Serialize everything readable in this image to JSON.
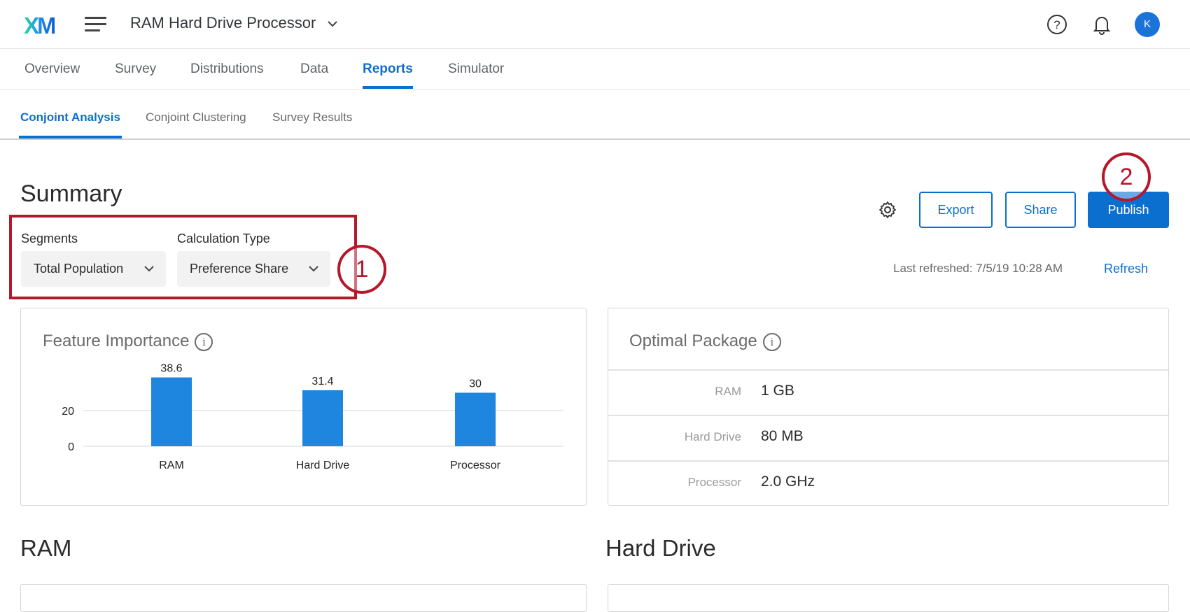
{
  "header": {
    "logo": "XM",
    "project_title": "RAM Hard Drive Processor",
    "avatar_initial": "K"
  },
  "tabs": [
    {
      "label": "Overview"
    },
    {
      "label": "Survey"
    },
    {
      "label": "Distributions"
    },
    {
      "label": "Data"
    },
    {
      "label": "Reports",
      "active": true
    },
    {
      "label": "Simulator"
    }
  ],
  "subtabs": [
    {
      "label": "Conjoint Analysis",
      "active": true
    },
    {
      "label": "Conjoint Clustering"
    },
    {
      "label": "Survey Results"
    }
  ],
  "summary": {
    "title": "Summary",
    "segments_label": "Segments",
    "segments_value": "Total Population",
    "calc_label": "Calculation Type",
    "calc_value": "Preference Share",
    "export": "Export",
    "share": "Share",
    "publish": "Publish",
    "last_refreshed": "Last refreshed: 7/5/19 10:28 AM",
    "refresh": "Refresh"
  },
  "annotations": [
    "1",
    "2"
  ],
  "feature_importance": {
    "title": "Feature Importance"
  },
  "chart_data": {
    "type": "bar",
    "title": "Feature Importance",
    "categories": [
      "RAM",
      "Hard Drive",
      "Processor"
    ],
    "values": [
      38.6,
      31.4,
      30
    ],
    "value_labels": [
      "38.6",
      "31.4",
      "30"
    ],
    "yticks": [
      0,
      20
    ],
    "ylim": [
      0,
      40
    ],
    "xlabel": "",
    "ylabel": "",
    "color": "#1f86e0"
  },
  "optimal_package": {
    "title": "Optimal Package",
    "rows": [
      {
        "attribute": "RAM",
        "value": "1 GB"
      },
      {
        "attribute": "Hard Drive",
        "value": "80 MB"
      },
      {
        "attribute": "Processor",
        "value": "2.0 GHz"
      }
    ]
  },
  "sections": [
    "RAM",
    "Hard Drive"
  ],
  "colors": {
    "accent": "#0b6fd0",
    "annotation": "#b5172b",
    "bar": "#1f86e0"
  }
}
